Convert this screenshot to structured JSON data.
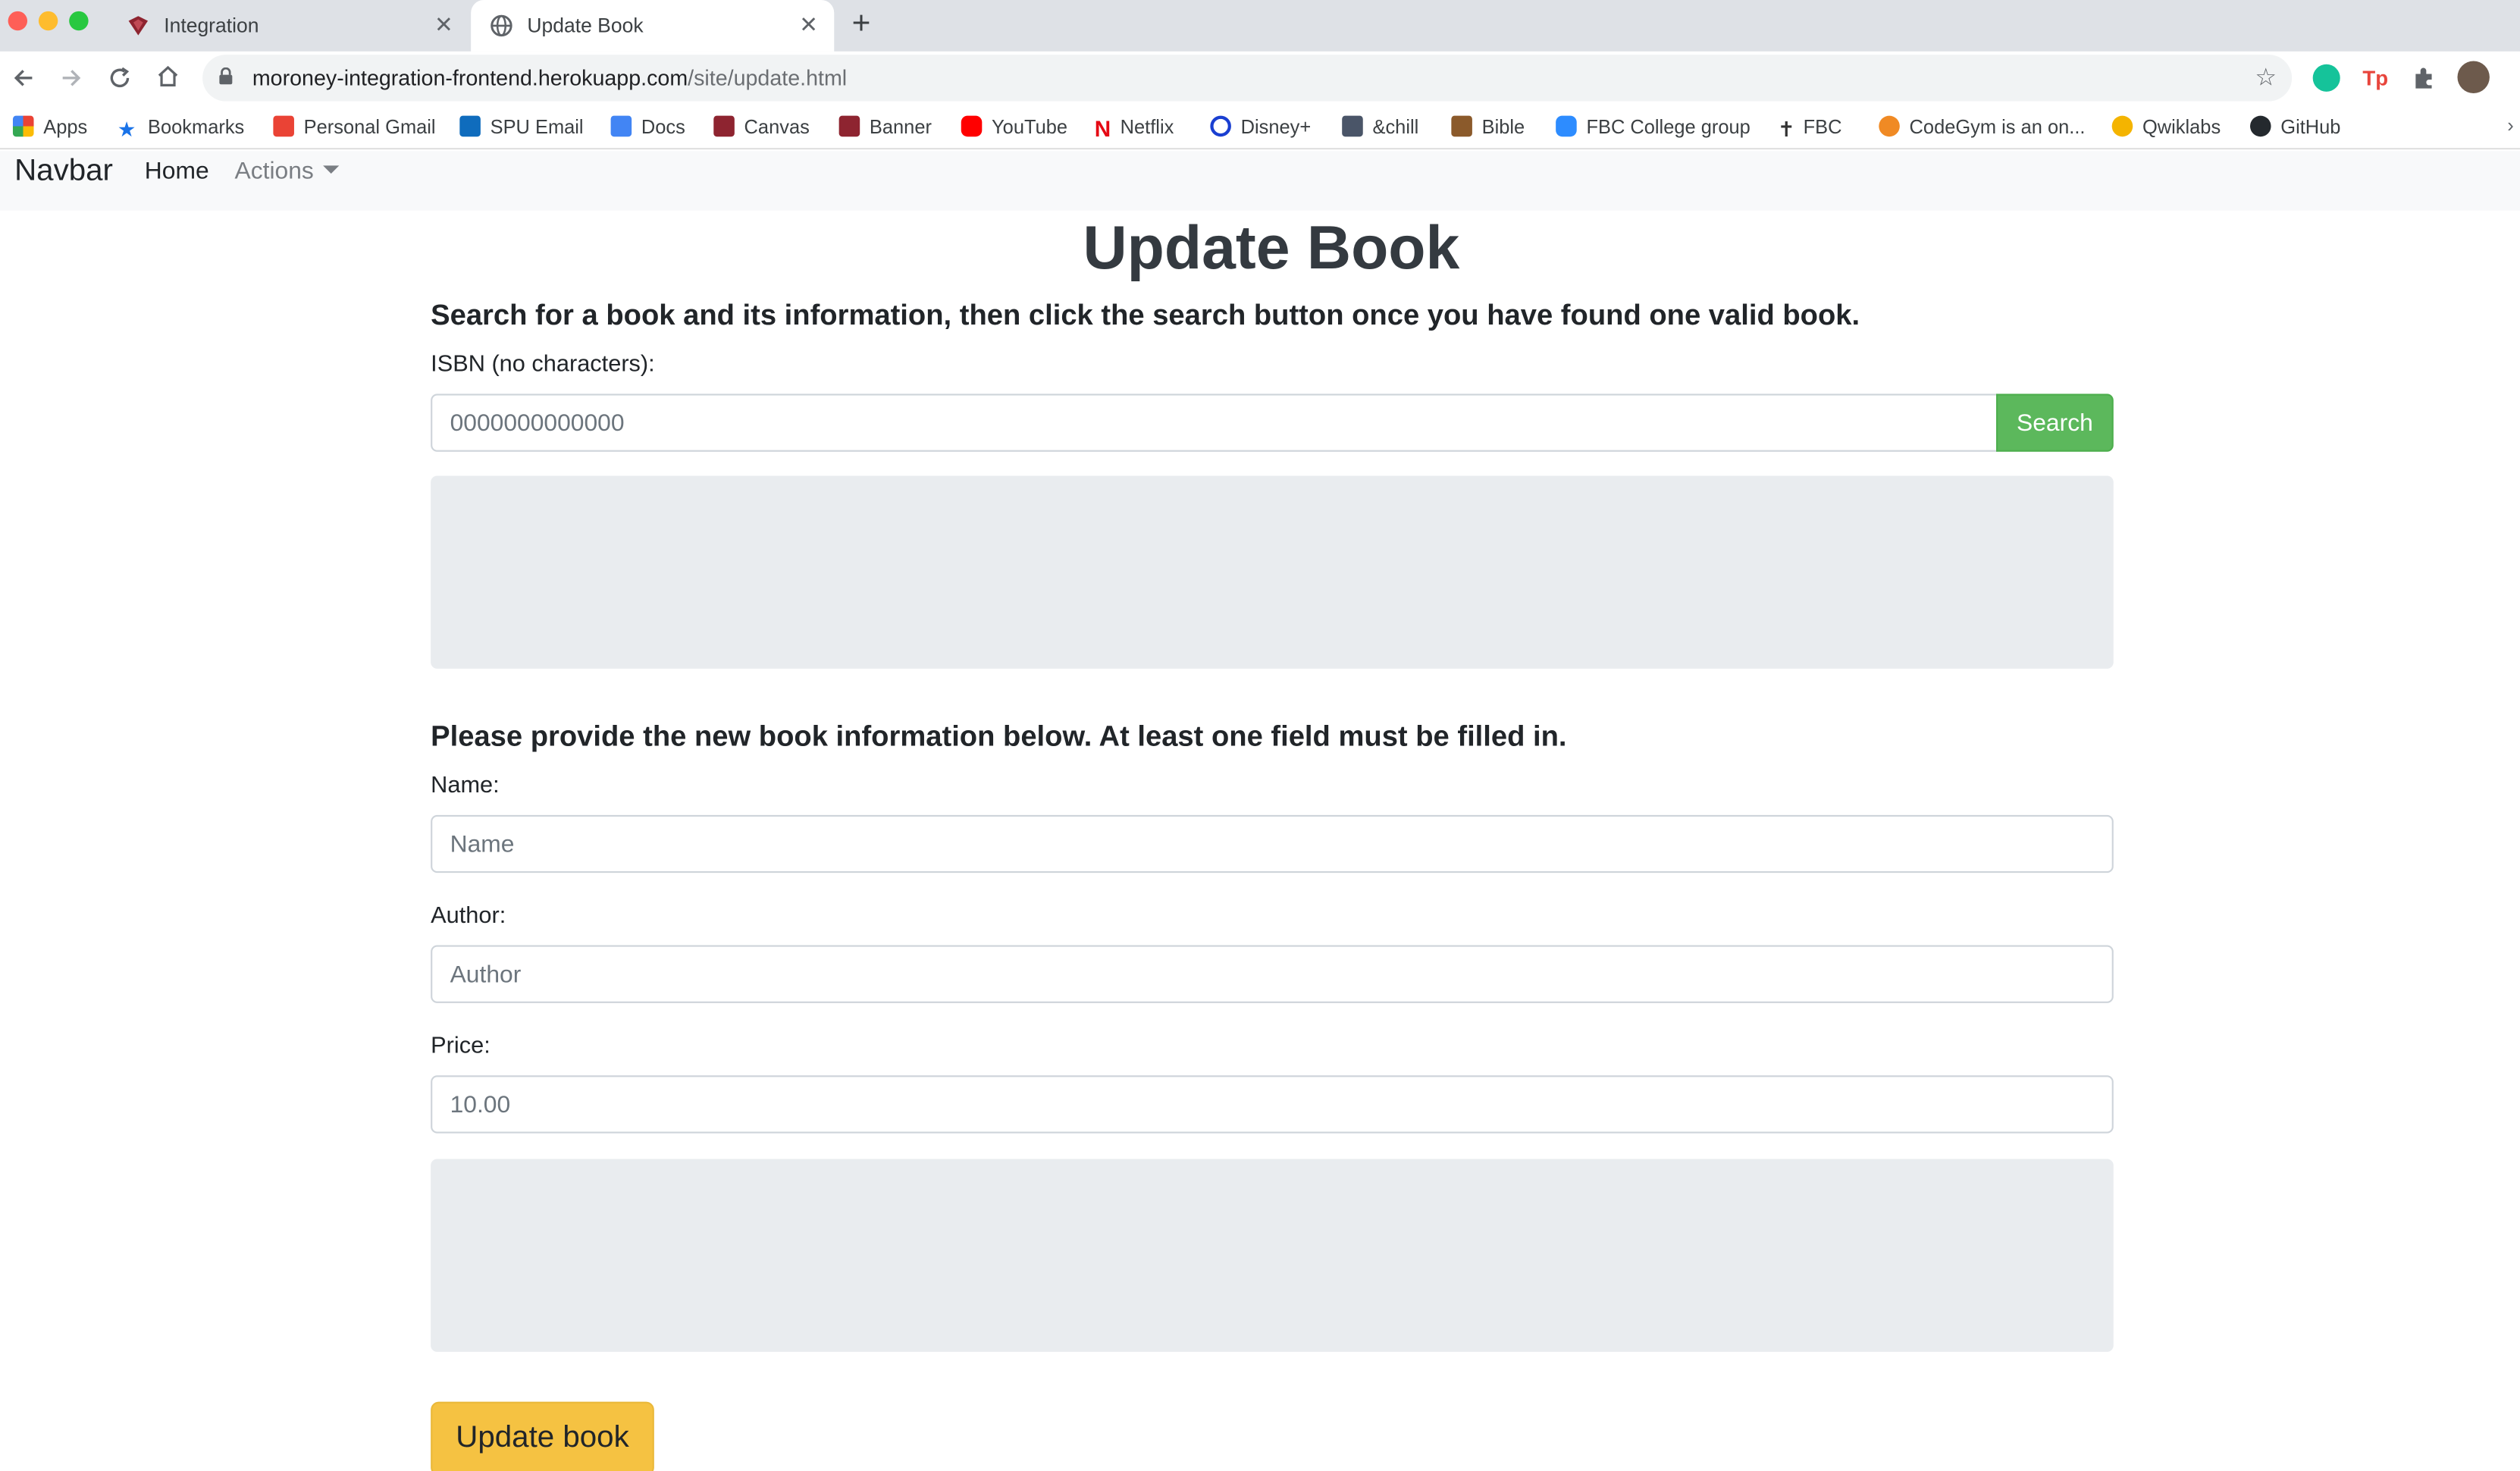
{
  "browser": {
    "tabs": [
      {
        "title": "Integration"
      },
      {
        "title": "Update Book"
      }
    ],
    "tab_close_glyph": "✕",
    "new_tab_glyph": "+",
    "url": {
      "host": "moroney-integration-frontend.herokuapp.com",
      "path": "/site/update.html"
    },
    "bookmarks": [
      {
        "label": "Apps",
        "icon": "apps-grid-icon",
        "color": "#ea4335"
      },
      {
        "label": "Bookmarks",
        "icon": "star-icon",
        "color": "#1a73e8"
      },
      {
        "label": "Personal Gmail",
        "icon": "gmail-icon",
        "color": "#ea4335"
      },
      {
        "label": "SPU Email",
        "icon": "outlook-icon",
        "color": "#0f6cbd"
      },
      {
        "label": "Docs",
        "icon": "docs-icon",
        "color": "#4285f4"
      },
      {
        "label": "Canvas",
        "icon": "canvas-icon",
        "color": "#8e2430"
      },
      {
        "label": "Banner",
        "icon": "banner-icon",
        "color": "#8e2430"
      },
      {
        "label": "YouTube",
        "icon": "youtube-icon",
        "color": "#ff0000"
      },
      {
        "label": "Netflix",
        "icon": "netflix-icon",
        "color": "#e50914"
      },
      {
        "label": "Disney+",
        "icon": "disney-icon",
        "color": "#1a3fd1"
      },
      {
        "label": "&chill",
        "icon": "chill-icon",
        "color": "#4a5568"
      },
      {
        "label": "Bible",
        "icon": "bible-icon",
        "color": "#8b5a2b"
      },
      {
        "label": "FBC College group",
        "icon": "zoom-icon",
        "color": "#2d8cff"
      },
      {
        "label": "FBC",
        "icon": "cross-icon",
        "color": "#333333"
      },
      {
        "label": "CodeGym is an on...",
        "icon": "codegym-icon",
        "color": "#f08a24"
      },
      {
        "label": "Qwiklabs",
        "icon": "qwiklabs-icon",
        "color": "#f4b400"
      },
      {
        "label": "GitHub",
        "icon": "github-icon",
        "color": "#24292e"
      }
    ],
    "more_bookmarks_glyph": "›"
  },
  "navbar": {
    "brand": "Navbar",
    "home": "Home",
    "actions": "Actions"
  },
  "page": {
    "title": "Update Book",
    "search_instructions": "Search for a book and its information, then click the search button once you have found one valid book.",
    "isbn_label": "ISBN (no characters):",
    "isbn_placeholder": "0000000000000",
    "search_button": "Search",
    "update_instructions": "Please provide the new book information below. At least one field must be filled in.",
    "name_label": "Name:",
    "name_placeholder": "Name",
    "author_label": "Author:",
    "author_placeholder": "Author",
    "price_label": "Price:",
    "price_placeholder": "10.00",
    "update_button": "Update book"
  },
  "colors": {
    "search_button": "#5cb85c",
    "update_button": "#f5c242",
    "result_panel": "#e9ecef"
  }
}
